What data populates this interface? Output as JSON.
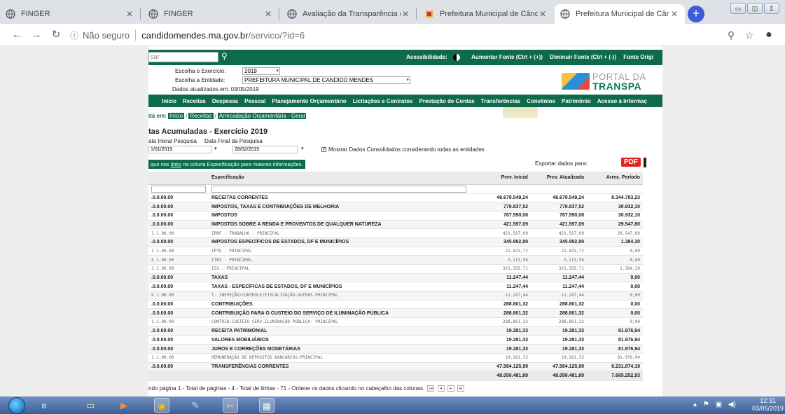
{
  "browser": {
    "tabs": [
      {
        "title": "FINGER",
        "active": false
      },
      {
        "title": "FINGER",
        "active": false
      },
      {
        "title": "Avaliação da Transparência dos",
        "active": false
      },
      {
        "title": "Prefeitura Municipal de Cândid",
        "active": false
      },
      {
        "title": "Prefeitura Municipal de Cândid",
        "active": true
      }
    ],
    "new_tab": "+",
    "address": {
      "security": "Não seguro",
      "host": "candidomendes.ma.gov.br",
      "path": "/servico/?id=6"
    }
  },
  "site": {
    "search_placeholder": "sar",
    "access_label": "Acessibilidade:",
    "font_up": "Aumentar Fonte (Ctrl + (+))",
    "font_down": "Diminuir Fonte (Ctrl + (-))",
    "font_orig": "Fonte Origi",
    "filter": {
      "exercicio_label": "Escolha o Exercício:",
      "exercicio_value": "2019",
      "entidade_label": "Escolha a Entidade:",
      "entidade_value": "PREFEITURA MUNICIPAL DE CANDIDO MENDES",
      "updated": "Dados atualizados em: 03/05/2019"
    },
    "logo": {
      "line1": "PORTAL DA",
      "line2": "TRANSPA"
    },
    "menu": [
      "Início",
      "Receitas",
      "Despesas",
      "Pessoal",
      "Planejamento Orçamentário",
      "Licitações e Contratos",
      "Prestação de Contas",
      "Transferências",
      "Convênios",
      "Patrimônio",
      "Acesso à Informaç"
    ],
    "breadcrumb": {
      "label": "itá em:",
      "items": [
        "Início",
        "Receitas",
        "Arrecadação Orçamentária - Geral"
      ]
    },
    "title": "tas Acumuladas - Exercício 2019",
    "date_initial_label": "ata Inicial Pesquisa",
    "date_initial_value": "1/01/2019",
    "date_final_label": "Data Final da Pesquisa",
    "date_final_value": "28/02/2019",
    "consolidated_label": "Mostrar Dados Consolidados considerando todas as entidades",
    "consolidated_checked": true,
    "hint_prefix": "que nos ",
    "hint_link": "links",
    "hint_suffix": " na coluna Especificação para maiores informações.",
    "export_label": "Exportar dados para:",
    "pdf_label": "PDF"
  },
  "table": {
    "headers": [
      "",
      "Especificação",
      "Prev. Inicial",
      "Prev. Atualizada",
      "Arrec. Período"
    ],
    "rows": [
      {
        "code": ".0.0.00.00",
        "spec": "RECEITAS CORRENTES",
        "prev_ini": "48.679.549,24",
        "prev_atu": "48.679.549,24",
        "arrec": "8.344.783,23",
        "style": "bold"
      },
      {
        "code": ".0.0.00.00",
        "spec": "IMPOSTOS, TAXAS E CONTRIBUIÇÕES DE MELHORIA",
        "prev_ini": "778.837,52",
        "prev_atu": "778.837,52",
        "arrec": "30.932,10",
        "style": "bold"
      },
      {
        "code": ".0.0.00.00",
        "spec": "IMPOSTOS",
        "prev_ini": "767.590,08",
        "prev_atu": "767.590,08",
        "arrec": "30.932,10",
        "style": "bold"
      },
      {
        "code": ".0.0.00.00",
        "spec": "IMPOSTOS SOBRE A RENDA E PROVENTOS DE QUALQUER NATUREZA",
        "prev_ini": "421.597,09",
        "prev_atu": "421.597,09",
        "arrec": "29.547,80",
        "style": "bold"
      },
      {
        "code": "1.1.00.00",
        "spec": "IRRF - TRABALHO - PRINCIPAL",
        "prev_ini": "421.597,09",
        "prev_atu": "421.597,09",
        "arrec": "29.547,80",
        "style": "light"
      },
      {
        "code": ".0.0.00.00",
        "spec": "IMPOSTOS ESPECÍFICOS DE ESTADOS, DF E MUNICÍPIOS",
        "prev_ini": "345.992,99",
        "prev_atu": "345.992,99",
        "arrec": "1.384,30",
        "style": "bold"
      },
      {
        "code": "1.1.00.00",
        "spec": "IPTU - PRINCIPAL",
        "prev_ini": "21.423,72",
        "prev_atu": "21.423,72",
        "arrec": "0,00",
        "style": "light"
      },
      {
        "code": "4.1.00.00",
        "spec": "ITBI - PRINCIPAL",
        "prev_ini": "3.213,56",
        "prev_atu": "3.213,56",
        "arrec": "0,00",
        "style": "light"
      },
      {
        "code": "3.1.00.00",
        "spec": "ISS - PRINCIPAL",
        "prev_ini": "321.355,71",
        "prev_atu": "321.355,71",
        "arrec": "1.384,30",
        "style": "light"
      },
      {
        "code": ".0.0.00.00",
        "spec": "TAXAS",
        "prev_ini": "11.247,44",
        "prev_atu": "11.247,44",
        "arrec": "0,00",
        "style": "bold"
      },
      {
        "code": ".0.0.00.00",
        "spec": "TAXAS - ESPECÍFICAS DE ESTADOS, DF E MUNICÍPIOS",
        "prev_ini": "11.247,44",
        "prev_atu": "11.247,44",
        "arrec": "0,00",
        "style": "bold"
      },
      {
        "code": "9.1.00.00",
        "spec": "T. INSPEÇÃO/CONTROLE/FISCALIZAÇÃO-OUTRAS-PRINCIPAL",
        "prev_ini": "11.247,44",
        "prev_atu": "11.247,44",
        "arrec": "0,00",
        "style": "light"
      },
      {
        "code": ".0.0.00.00",
        "spec": "CONTRIBUIÇÕES",
        "prev_ini": "288.801,32",
        "prev_atu": "288.801,32",
        "arrec": "0,00",
        "style": "bold"
      },
      {
        "code": ".0.0.00.00",
        "spec": "CONTRIBUIÇÃO PARA O CUSTEIO DO SERVIÇO DE ILUMINAÇÃO PÚBLICA",
        "prev_ini": "288.801,32",
        "prev_atu": "288.801,32",
        "arrec": "0,00",
        "style": "bold"
      },
      {
        "code": "1.1.00.00",
        "spec": "CONTRIB.CUSTEIO SERV.ILUMINAÇÃO PÚBLICA- PRINCIPAL",
        "prev_ini": "288.801,32",
        "prev_atu": "288.801,32",
        "arrec": "0,00",
        "style": "light"
      },
      {
        "code": ".0.0.00.00",
        "spec": "RECEITA PATRIMONIAL",
        "prev_ini": "19.281,33",
        "prev_atu": "19.281,33",
        "arrec": "81.976,94",
        "style": "bold"
      },
      {
        "code": ".0.0.00.00",
        "spec": "VALORES MOBILIÁRIOS",
        "prev_ini": "19.281,33",
        "prev_atu": "19.281,33",
        "arrec": "81.976,94",
        "style": "bold"
      },
      {
        "code": ".0.0.00.00",
        "spec": "JUROS E CORREÇÕES MONETÁRIAS",
        "prev_ini": "19.281,33",
        "prev_atu": "19.281,33",
        "arrec": "81.976,94",
        "style": "bold"
      },
      {
        "code": "1.1.00.00",
        "spec": "REMUNERAÇÃO DE DEPÓSITOS BANCÁRIOS-PRINCIPAL",
        "prev_ini": "19.281,33",
        "prev_atu": "19.281,33",
        "arrec": "81.976,94",
        "style": "light"
      },
      {
        "code": ".0.0.00.00",
        "spec": "TRANSFERÊNCIAS CORRENTES",
        "prev_ini": "47.584.125,99",
        "prev_atu": "47.584.125,99",
        "arrec": "8.231.874,19",
        "style": "bold"
      }
    ],
    "totals": {
      "prev_ini": "48.050.481,89",
      "prev_atu": "48.050.481,89",
      "arrec": "7.665.252,93"
    }
  },
  "pager_text": "ndo página 1 - Total de páginas - 4 - Total de linhas - 71 - Ordene os dados clicando no cabeçalho das colunas.",
  "taskbar": {
    "time": "12:31",
    "date": "03/05/2019"
  },
  "colors": {
    "site_green": "#0d6b4b",
    "pdf_red": "#e02424"
  }
}
